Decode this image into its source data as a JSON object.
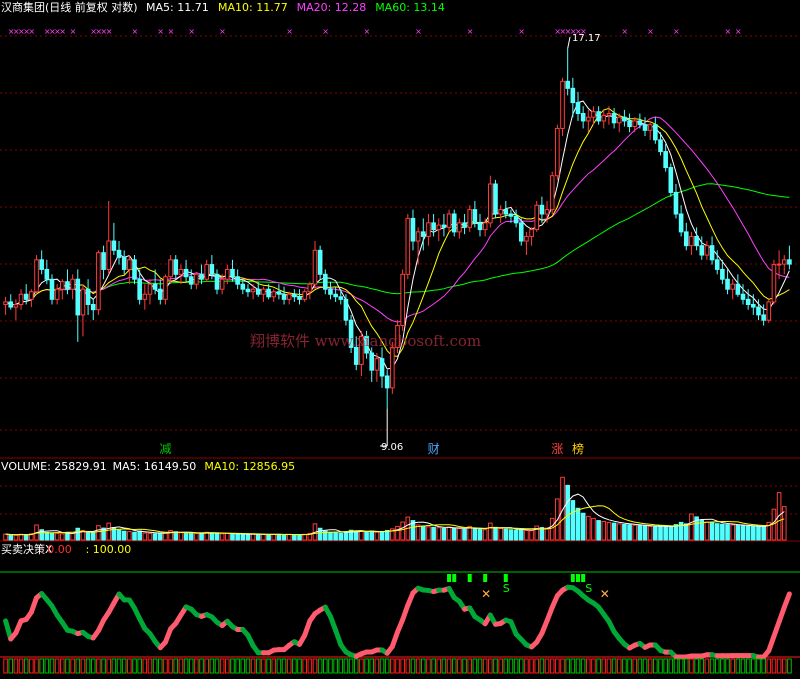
{
  "header": {
    "title": "汉商集团(日线 前复权 对数)",
    "ma": [
      {
        "label": "MA5: 11.71",
        "color": "#ffffff"
      },
      {
        "label": "MA10: 11.77",
        "color": "#ffff00"
      },
      {
        "label": "MA20: 12.28",
        "color": "#ff40ff"
      },
      {
        "label": "MA60: 13.14",
        "color": "#00ff00"
      }
    ]
  },
  "volume_header": {
    "items": [
      {
        "label": "VOLUME: 25829.91",
        "color": "#ffffff"
      },
      {
        "label": "MA5: 16149.50",
        "color": "#ffffff"
      },
      {
        "label": "MA10: 12856.95",
        "color": "#ffff00"
      }
    ]
  },
  "indicator_header": {
    "items": [
      {
        "label": "买卖决策X",
        "color": "#ffffff"
      },
      {
        "label": ": 0.00",
        "color": "#ff3030"
      },
      {
        "label": ": 100.00",
        "color": "#ffff00"
      }
    ]
  },
  "annotations": {
    "high_label": "17.17",
    "low_label": "9.06",
    "badges": [
      {
        "text": "减",
        "color": "#00c800",
        "day": 31
      },
      {
        "text": "财",
        "color": "#4aa8ff",
        "day": 83
      },
      {
        "text": "涨",
        "color": "#ff4040",
        "day": 107
      },
      {
        "text": "榜",
        "color": "#ffd000",
        "day": 111
      }
    ],
    "watermark": "翔博软件 www.xiangbosoft.com",
    "s_marks": [
      {
        "text": "S",
        "day": 97
      },
      {
        "text": "S",
        "day": 113
      }
    ],
    "x_marks": [
      {
        "text": "✕",
        "day": 93
      },
      {
        "text": "✕",
        "day": 116
      }
    ]
  },
  "colors": {
    "up": "#ff3c3c",
    "down": "#54ffff",
    "ma5": "#ffffff",
    "ma10": "#ffff00",
    "ma20": "#ff40ff",
    "ma60": "#00ff00",
    "grid": "#8a0000",
    "indicator_pink": "#ff5a6e",
    "indicator_green": "#00a838"
  },
  "chart_data": {
    "type": "candlestick",
    "scale": "log",
    "price_ylim": [
      8.8,
      18.0
    ],
    "days": 158,
    "candles": [
      [
        10.9,
        11.05,
        10.7,
        10.95
      ],
      [
        10.95,
        11.1,
        10.8,
        10.85
      ],
      [
        10.85,
        11.0,
        10.6,
        10.9
      ],
      [
        10.9,
        11.2,
        10.8,
        11.1
      ],
      [
        11.1,
        11.3,
        10.9,
        11.0
      ],
      [
        11.0,
        11.2,
        10.85,
        11.15
      ],
      [
        11.15,
        11.9,
        11.1,
        11.8
      ],
      [
        11.8,
        12.0,
        11.5,
        11.6
      ],
      [
        11.6,
        11.8,
        11.3,
        11.4
      ],
      [
        11.4,
        11.5,
        10.9,
        11.0
      ],
      [
        11.0,
        11.3,
        10.9,
        11.2
      ],
      [
        11.2,
        11.4,
        11.0,
        11.35
      ],
      [
        11.35,
        11.6,
        11.1,
        11.2
      ],
      [
        11.2,
        11.5,
        11.0,
        11.4
      ],
      [
        11.4,
        11.6,
        10.2,
        10.7
      ],
      [
        10.7,
        11.3,
        10.3,
        11.2
      ],
      [
        11.2,
        11.4,
        10.7,
        10.9
      ],
      [
        10.9,
        11.0,
        10.6,
        10.8
      ],
      [
        10.8,
        12.0,
        10.7,
        11.95
      ],
      [
        11.95,
        12.1,
        11.4,
        11.6
      ],
      [
        11.6,
        13.1,
        11.5,
        12.2
      ],
      [
        12.2,
        12.6,
        11.9,
        12.0
      ],
      [
        12.0,
        12.2,
        11.7,
        11.85
      ],
      [
        11.85,
        12.0,
        11.5,
        11.6
      ],
      [
        11.6,
        11.9,
        11.3,
        11.8
      ],
      [
        11.8,
        11.9,
        11.3,
        11.4
      ],
      [
        11.4,
        11.6,
        10.9,
        11.0
      ],
      [
        11.0,
        11.3,
        10.8,
        11.1
      ],
      [
        11.1,
        11.4,
        10.9,
        11.3
      ],
      [
        11.3,
        11.6,
        11.1,
        11.2
      ],
      [
        11.2,
        11.4,
        10.9,
        11.0
      ],
      [
        11.0,
        11.5,
        10.9,
        11.45
      ],
      [
        11.45,
        11.9,
        11.3,
        11.8
      ],
      [
        11.8,
        11.9,
        11.4,
        11.5
      ],
      [
        11.5,
        11.7,
        11.3,
        11.6
      ],
      [
        11.6,
        11.8,
        11.35,
        11.45
      ],
      [
        11.45,
        11.6,
        11.2,
        11.3
      ],
      [
        11.3,
        11.55,
        11.2,
        11.5
      ],
      [
        11.5,
        11.7,
        11.3,
        11.4
      ],
      [
        11.4,
        11.8,
        11.35,
        11.7
      ],
      [
        11.7,
        11.9,
        11.4,
        11.5
      ],
      [
        11.5,
        11.6,
        11.1,
        11.2
      ],
      [
        11.2,
        11.5,
        11.1,
        11.4
      ],
      [
        11.4,
        11.7,
        11.3,
        11.6
      ],
      [
        11.6,
        11.8,
        11.35,
        11.45
      ],
      [
        11.45,
        11.6,
        11.2,
        11.3
      ],
      [
        11.3,
        11.4,
        11.1,
        11.2
      ],
      [
        11.2,
        11.3,
        11.05,
        11.15
      ],
      [
        11.15,
        11.3,
        11.0,
        11.2
      ],
      [
        11.2,
        11.35,
        11.05,
        11.1
      ],
      [
        11.1,
        11.25,
        10.95,
        11.2
      ],
      [
        11.2,
        11.3,
        11.0,
        11.05
      ],
      [
        11.05,
        11.2,
        10.95,
        11.15
      ],
      [
        11.15,
        11.3,
        11.0,
        11.1
      ],
      [
        11.1,
        11.25,
        10.9,
        11.0
      ],
      [
        11.0,
        11.15,
        10.9,
        11.1
      ],
      [
        11.1,
        11.2,
        10.95,
        11.05
      ],
      [
        11.05,
        11.2,
        10.9,
        11.0
      ],
      [
        11.0,
        11.2,
        10.95,
        11.15
      ],
      [
        11.15,
        11.35,
        11.0,
        11.3
      ],
      [
        11.3,
        12.2,
        11.2,
        12.0
      ],
      [
        12.0,
        12.1,
        11.4,
        11.5
      ],
      [
        11.5,
        11.6,
        11.1,
        11.2
      ],
      [
        11.2,
        11.35,
        11.0,
        11.1
      ],
      [
        11.1,
        11.25,
        10.95,
        11.05
      ],
      [
        11.05,
        11.2,
        10.9,
        11.0
      ],
      [
        11.0,
        11.1,
        10.5,
        10.6
      ],
      [
        10.6,
        10.7,
        10.0,
        10.1
      ],
      [
        10.1,
        10.3,
        9.7,
        9.8
      ],
      [
        9.8,
        10.4,
        9.6,
        10.3
      ],
      [
        10.3,
        10.4,
        9.9,
        10.0
      ],
      [
        10.0,
        10.1,
        9.5,
        9.7
      ],
      [
        9.7,
        10.0,
        9.5,
        9.9
      ],
      [
        9.9,
        10.1,
        9.4,
        9.6
      ],
      [
        9.6,
        9.7,
        9.06,
        9.4
      ],
      [
        9.4,
        10.2,
        9.3,
        10.1
      ],
      [
        10.1,
        10.6,
        10.0,
        10.5
      ],
      [
        10.5,
        11.6,
        10.4,
        11.5
      ],
      [
        11.5,
        12.8,
        11.4,
        12.7
      ],
      [
        12.7,
        12.9,
        12.0,
        12.2
      ],
      [
        12.2,
        12.5,
        11.7,
        12.4
      ],
      [
        12.4,
        12.7,
        12.0,
        12.3
      ],
      [
        12.3,
        12.8,
        12.1,
        12.6
      ],
      [
        12.6,
        12.8,
        12.3,
        12.45
      ],
      [
        12.45,
        12.7,
        12.2,
        12.55
      ],
      [
        12.55,
        12.8,
        12.3,
        12.5
      ],
      [
        12.5,
        12.9,
        12.4,
        12.8
      ],
      [
        12.8,
        12.9,
        12.3,
        12.4
      ],
      [
        12.4,
        12.7,
        12.25,
        12.6
      ],
      [
        12.6,
        12.8,
        12.35,
        12.5
      ],
      [
        12.5,
        13.0,
        12.4,
        12.9
      ],
      [
        12.9,
        13.1,
        12.5,
        12.6
      ],
      [
        12.6,
        12.8,
        12.3,
        12.45
      ],
      [
        12.45,
        12.7,
        12.3,
        12.6
      ],
      [
        12.6,
        13.7,
        12.5,
        13.5
      ],
      [
        13.5,
        13.6,
        12.7,
        12.8
      ],
      [
        12.8,
        13.0,
        12.6,
        12.9
      ],
      [
        12.9,
        13.1,
        12.7,
        12.8
      ],
      [
        12.8,
        12.9,
        12.6,
        12.75
      ],
      [
        12.75,
        12.9,
        12.5,
        12.6
      ],
      [
        12.6,
        12.7,
        12.1,
        12.2
      ],
      [
        12.2,
        12.4,
        11.9,
        12.3
      ],
      [
        12.3,
        12.5,
        12.1,
        12.45
      ],
      [
        12.45,
        13.1,
        12.4,
        13.0
      ],
      [
        13.0,
        13.2,
        12.6,
        12.8
      ],
      [
        12.8,
        13.1,
        12.6,
        12.9
      ],
      [
        12.9,
        13.8,
        12.8,
        13.7
      ],
      [
        13.7,
        15.0,
        13.6,
        14.9
      ],
      [
        14.9,
        16.3,
        14.7,
        16.2
      ],
      [
        16.2,
        17.17,
        15.8,
        16.0
      ],
      [
        16.0,
        16.3,
        15.2,
        15.6
      ],
      [
        15.6,
        15.9,
        15.1,
        15.3
      ],
      [
        15.3,
        15.5,
        14.9,
        15.1
      ],
      [
        15.1,
        15.4,
        14.8,
        15.2
      ],
      [
        15.2,
        15.5,
        15.0,
        15.35
      ],
      [
        15.35,
        15.5,
        15.0,
        15.1
      ],
      [
        15.1,
        15.4,
        14.9,
        15.25
      ],
      [
        15.25,
        15.5,
        15.0,
        15.3
      ],
      [
        15.3,
        15.45,
        14.9,
        15.05
      ],
      [
        15.05,
        15.3,
        14.8,
        15.2
      ],
      [
        15.2,
        15.4,
        14.95,
        15.1
      ],
      [
        15.1,
        15.3,
        14.8,
        14.95
      ],
      [
        14.95,
        15.2,
        14.8,
        15.1
      ],
      [
        15.1,
        15.3,
        14.9,
        15.0
      ],
      [
        15.0,
        15.2,
        14.7,
        14.85
      ],
      [
        14.85,
        15.1,
        14.6,
        15.0
      ],
      [
        15.0,
        15.2,
        14.5,
        14.6
      ],
      [
        14.6,
        14.8,
        14.2,
        14.3
      ],
      [
        14.3,
        14.5,
        13.8,
        13.9
      ],
      [
        13.9,
        14.0,
        13.2,
        13.3
      ],
      [
        13.3,
        13.5,
        12.7,
        12.8
      ],
      [
        12.8,
        13.0,
        12.3,
        12.4
      ],
      [
        12.4,
        12.6,
        12.0,
        12.1
      ],
      [
        12.1,
        12.4,
        11.9,
        12.3
      ],
      [
        12.3,
        12.5,
        12.0,
        12.1
      ],
      [
        12.1,
        12.3,
        11.8,
        11.9
      ],
      [
        11.9,
        12.2,
        11.8,
        12.1
      ],
      [
        12.1,
        12.3,
        11.7,
        11.8
      ],
      [
        11.8,
        12.0,
        11.5,
        11.6
      ],
      [
        11.6,
        11.8,
        11.3,
        11.4
      ],
      [
        11.4,
        11.6,
        11.1,
        11.2
      ],
      [
        11.2,
        11.4,
        11.0,
        11.3
      ],
      [
        11.3,
        11.5,
        11.05,
        11.1
      ],
      [
        11.1,
        11.3,
        10.9,
        11.0
      ],
      [
        11.0,
        11.2,
        10.8,
        10.9
      ],
      [
        10.9,
        11.1,
        10.7,
        10.85
      ],
      [
        10.85,
        11.0,
        10.6,
        10.7
      ],
      [
        10.7,
        10.9,
        10.5,
        10.6
      ],
      [
        10.6,
        11.0,
        10.55,
        10.95
      ],
      [
        10.95,
        11.8,
        10.9,
        11.7
      ],
      [
        11.7,
        12.0,
        11.4,
        11.71
      ],
      [
        11.71,
        11.9,
        11.5,
        11.8
      ],
      [
        11.8,
        12.1,
        11.6,
        11.71
      ]
    ],
    "volume": [
      3200,
      2800,
      2600,
      3100,
      2900,
      3400,
      8200,
      5600,
      4100,
      3800,
      3600,
      3300,
      3900,
      3500,
      6400,
      5200,
      4300,
      3900,
      7800,
      6500,
      9200,
      6800,
      5400,
      4800,
      4600,
      4200,
      4900,
      3800,
      3600,
      3400,
      3500,
      4100,
      5200,
      4500,
      4000,
      3800,
      3600,
      3500,
      3700,
      4200,
      3900,
      3500,
      3400,
      3600,
      3300,
      3200,
      3100,
      3000,
      3200,
      3100,
      3000,
      2900,
      3000,
      3100,
      2900,
      3000,
      2950,
      2900,
      3100,
      3600,
      8800,
      6400,
      4800,
      4200,
      3900,
      3700,
      4600,
      5300,
      4700,
      5100,
      4400,
      4900,
      4300,
      4600,
      5200,
      6100,
      7400,
      9800,
      12500,
      10600,
      8200,
      7600,
      7200,
      6900,
      6700,
      6400,
      7100,
      6300,
      6200,
      5900,
      7400,
      6100,
      5700,
      5600,
      9200,
      6900,
      6300,
      5900,
      5600,
      5400,
      5800,
      5200,
      5100,
      7600,
      6800,
      6500,
      11800,
      22400,
      34200,
      29800,
      21500,
      17300,
      14600,
      12900,
      11800,
      10600,
      10100,
      9600,
      9200,
      8800,
      8500,
      8300,
      8100,
      7900,
      7600,
      7400,
      7200,
      7800,
      7300,
      7100,
      8400,
      9600,
      8800,
      14200,
      12600,
      10800,
      9800,
      9400,
      8900,
      8600,
      8400,
      8200,
      7900,
      7700,
      7500,
      7400,
      7300,
      7200,
      9600,
      16800,
      25829.91,
      18200
    ],
    "indicator_labels": [
      "0.00",
      "100.00"
    ]
  }
}
